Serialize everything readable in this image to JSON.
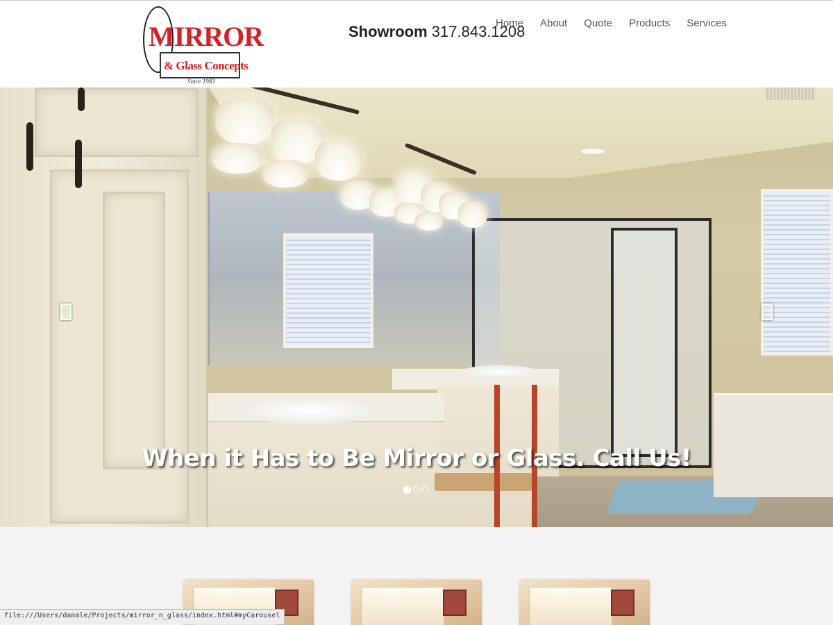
{
  "header": {
    "logo": {
      "main": "MIRROR",
      "sub": "& Glass Concepts",
      "since": "Since 1983"
    },
    "showroom_label": "Showroom",
    "showroom_phone": "317.843.1208",
    "nav": [
      {
        "label": "Home"
      },
      {
        "label": "About"
      },
      {
        "label": "Quote"
      },
      {
        "label": "Products"
      },
      {
        "label": "Services"
      }
    ]
  },
  "carousel": {
    "caption": "When it Has to Be Mirror or Glass. Call Us!",
    "slide_count": 3,
    "active_slide": 1,
    "prev_icon": "carousel-prev-icon",
    "next_icon": "carousel-next-icon"
  },
  "thumbnails": [
    {
      "name": "product-thumb-1"
    },
    {
      "name": "product-thumb-2"
    },
    {
      "name": "product-thumb-3"
    }
  ],
  "status_bar": {
    "url": "file:///Users/danale/Projects/mirror_n_glass/index.html#myCarousel"
  },
  "colors": {
    "brand_red": "#d42227",
    "nav_text": "#555555",
    "background": "#ffffff"
  }
}
